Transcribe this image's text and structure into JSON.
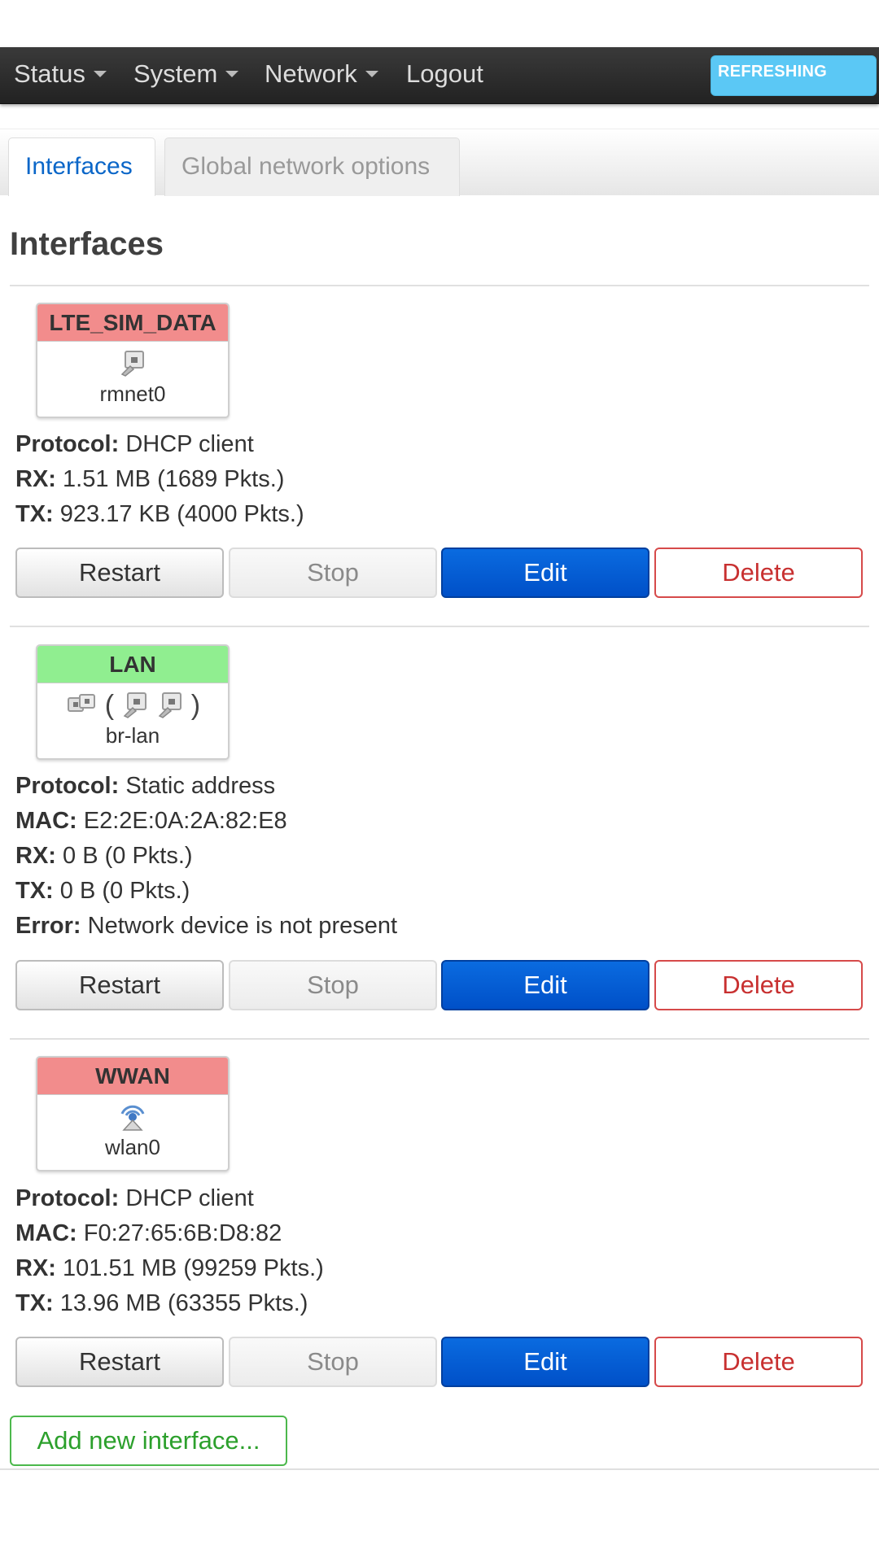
{
  "nav": {
    "items": [
      {
        "label": "Status",
        "has_dropdown": true
      },
      {
        "label": "System",
        "has_dropdown": true
      },
      {
        "label": "Network",
        "has_dropdown": true
      },
      {
        "label": "Logout",
        "has_dropdown": false
      }
    ],
    "status_badge": "REFRESHING"
  },
  "tabs": [
    {
      "label": "Interfaces",
      "active": true
    },
    {
      "label": "Global network options",
      "active": false
    }
  ],
  "page_title": "Interfaces",
  "interfaces": [
    {
      "name": "LTE_SIM_DATA",
      "header_color": "#f28c8c",
      "device": "rmnet0",
      "icon": "ethernet-port-icon",
      "lines": [
        {
          "label": "Protocol:",
          "value": "DHCP client"
        },
        {
          "label": "RX:",
          "value": "1.51 MB (1689 Pkts.)"
        },
        {
          "label": "TX:",
          "value": "923.17 KB (4000 Pkts.)"
        }
      ],
      "buttons": {
        "restart": "Restart",
        "stop": "Stop",
        "edit": "Edit",
        "delete": "Delete"
      }
    },
    {
      "name": "LAN",
      "header_color": "#90ee90",
      "device": "br-lan",
      "icon": "bridge-icon",
      "lines": [
        {
          "label": "Protocol:",
          "value": "Static address"
        },
        {
          "label": "MAC:",
          "value": "E2:2E:0A:2A:82:E8"
        },
        {
          "label": "RX:",
          "value": "0 B (0 Pkts.)"
        },
        {
          "label": "TX:",
          "value": "0 B (0 Pkts.)"
        },
        {
          "label": "Error:",
          "value": "Network device is not present"
        }
      ],
      "buttons": {
        "restart": "Restart",
        "stop": "Stop",
        "edit": "Edit",
        "delete": "Delete"
      }
    },
    {
      "name": "WWAN",
      "header_color": "#f28c8c",
      "device": "wlan0",
      "icon": "wireless-icon",
      "lines": [
        {
          "label": "Protocol:",
          "value": "DHCP client"
        },
        {
          "label": "MAC:",
          "value": "F0:27:65:6B:D8:82"
        },
        {
          "label": "RX:",
          "value": "101.51 MB (99259 Pkts.)"
        },
        {
          "label": "TX:",
          "value": "13.96 MB (63355 Pkts.)"
        }
      ],
      "buttons": {
        "restart": "Restart",
        "stop": "Stop",
        "edit": "Edit",
        "delete": "Delete"
      }
    }
  ],
  "add_button": "Add new interface...",
  "colors": {
    "nav_bg": "#2b2b2b",
    "badge": "#5bc8f5",
    "edit": "#0057d8",
    "delete": "#c83030",
    "add": "#2ca02c",
    "active_tab": "#0a66c8"
  }
}
